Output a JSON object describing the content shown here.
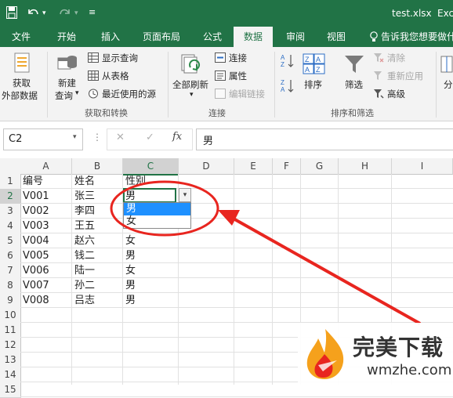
{
  "titlebar": {
    "file_name": "test.xlsx",
    "app_trunc": "Exc"
  },
  "tabs": [
    "文件",
    "开始",
    "插入",
    "页面布局",
    "公式",
    "数据",
    "审阅",
    "视图"
  ],
  "tell_me": "告诉我您想要做什么",
  "ribbon": {
    "get_data": {
      "line1": "获取",
      "line2": "外部数据"
    },
    "new_query": {
      "line1": "新建",
      "line2": "查询"
    },
    "show_queries": "显示查询",
    "from_table": "从表格",
    "recent_sources": "最近使用的源",
    "group_get": "获取和转换",
    "refresh_all": "全部刷新",
    "connections": "连接",
    "properties": "属性",
    "edit_links": "编辑链接",
    "group_conn": "连接",
    "sort": "排序",
    "filter": "筛选",
    "clear": "清除",
    "reapply": "重新应用",
    "advanced": "高级",
    "group_sort": "排序和筛选",
    "split_trunc": "分"
  },
  "formula_bar": {
    "name_box": "C2",
    "cancel": "✕",
    "enter": "✓",
    "fx": "fx",
    "content": "男"
  },
  "columns": [
    "A",
    "B",
    "C",
    "D",
    "E",
    "F",
    "G",
    "H",
    "I"
  ],
  "rows": [
    "1",
    "2",
    "3",
    "4",
    "5",
    "6",
    "7",
    "8",
    "9",
    "10",
    "11",
    "12",
    "13",
    "14",
    "15"
  ],
  "table": {
    "headers": [
      "编号",
      "姓名",
      "性别"
    ],
    "rows": [
      [
        "V001",
        "张三",
        "男"
      ],
      [
        "V002",
        "李四",
        ""
      ],
      [
        "V003",
        "王五",
        ""
      ],
      [
        "V004",
        "赵六",
        "女"
      ],
      [
        "V005",
        "钱二",
        "男"
      ],
      [
        "V006",
        "陆一",
        "女"
      ],
      [
        "V007",
        "孙二",
        "男"
      ],
      [
        "V008",
        "吕志",
        "男"
      ]
    ]
  },
  "dropdown": {
    "options": [
      "男",
      "女"
    ],
    "selected": "男"
  },
  "watermark": {
    "brand": "完美下载",
    "url": "wmzhe.com"
  },
  "colors": {
    "excel_green": "#217346",
    "annotation_red": "#e8251f",
    "select_blue": "#1e90ff"
  }
}
